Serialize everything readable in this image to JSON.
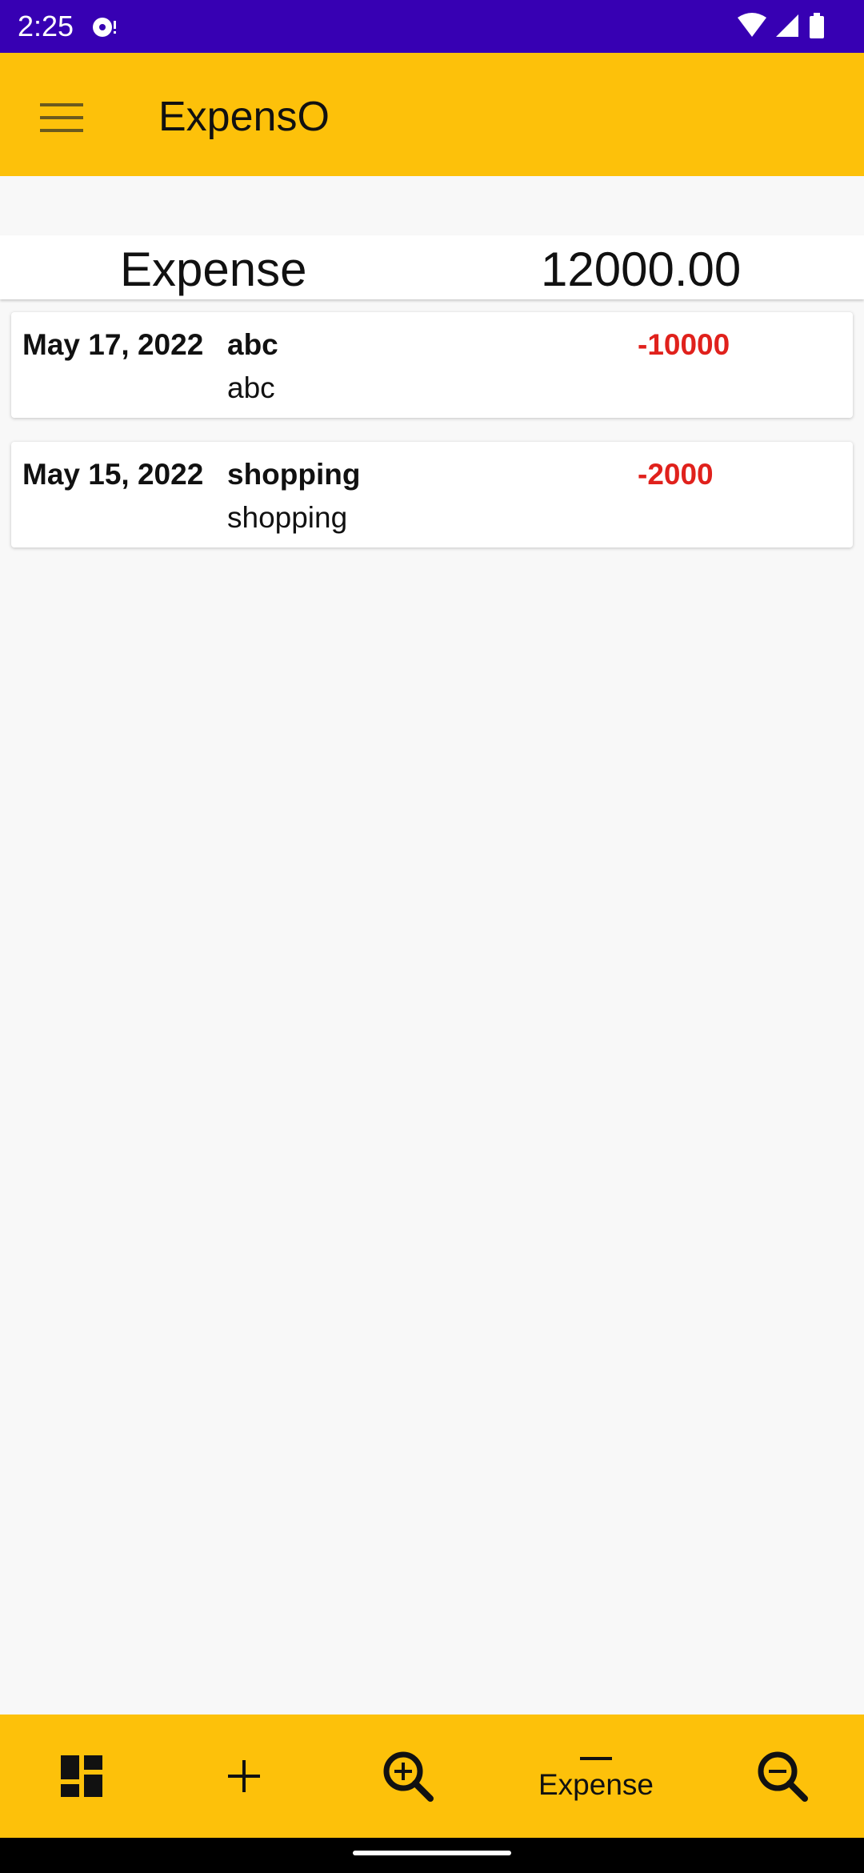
{
  "status": {
    "time": "2:25"
  },
  "app_bar": {
    "title": "ExpensO",
    "menu_icon": "hamburger-icon"
  },
  "summary": {
    "label": "Expense",
    "value": "12000.00"
  },
  "transactions": [
    {
      "date": "May 17, 2022",
      "title": "abc",
      "subtitle": "abc",
      "amount": "-10000"
    },
    {
      "date": "May 15, 2022",
      "title": "shopping",
      "subtitle": "shopping",
      "amount": "-2000"
    }
  ],
  "bottom_nav": {
    "items": [
      {
        "icon": "dashboard-icon",
        "label": ""
      },
      {
        "icon": "plus-icon",
        "label": ""
      },
      {
        "icon": "zoom-in-icon",
        "label": ""
      },
      {
        "icon": "minus-icon",
        "label": "Expense"
      },
      {
        "icon": "zoom-out-icon",
        "label": ""
      }
    ]
  },
  "colors": {
    "status_bar": "#3700b3",
    "app_bar": "#fdc10a",
    "negative_amount": "#e0211c",
    "background": "#f8f8f8"
  }
}
